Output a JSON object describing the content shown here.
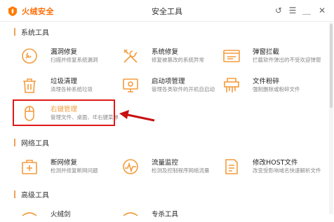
{
  "app": {
    "logo_text": "火绒安全",
    "window_title": "安全工具"
  },
  "controls": {
    "restore": "↺",
    "menu": "☰",
    "minimize": "＿",
    "close": "✕"
  },
  "colors": {
    "accent": "#f39c3d",
    "highlight": "#e01818"
  },
  "sections": [
    {
      "title": "系统工具",
      "items": [
        {
          "title": "漏洞修复",
          "desc": "扫描并修复系统漏洞",
          "icon": "shield-wrench-icon"
        },
        {
          "title": "系统修复",
          "desc": "修复被篡改的系统异常",
          "icon": "tools-icon"
        },
        {
          "title": "弹窗拦截",
          "desc": "拦截软件弹出的不受欢迎弹窗",
          "icon": "popup-window-icon"
        },
        {
          "title": "垃圾清理",
          "desc": "清理各种系统垃圾",
          "icon": "trash-icon"
        },
        {
          "title": "启动项管理",
          "desc": "管理各类软件的开机自启动",
          "icon": "monitor-startup-icon"
        },
        {
          "title": "文件粉碎",
          "desc": "强制删除或粉碎文件",
          "icon": "shredder-icon"
        },
        {
          "title": "右键管理",
          "desc": "管理文件、桌面、IE右键菜单",
          "icon": "mouse-icon"
        }
      ]
    },
    {
      "title": "网络工具",
      "items": [
        {
          "title": "断网修复",
          "desc": "检测并修复断网问题",
          "icon": "network-repair-icon"
        },
        {
          "title": "流量监控",
          "desc": "检测及控制程序网络流量",
          "icon": "traffic-gauge-icon"
        },
        {
          "title": "修改HOST文件",
          "desc": "改变受影响域名快速解析文件",
          "icon": "host-file-icon"
        }
      ]
    },
    {
      "title": "高级工具",
      "items": [
        {
          "title": "火绒剑",
          "icon": "sword-icon"
        },
        {
          "title": "专杀工具",
          "icon": "kill-tool-icon"
        }
      ]
    }
  ]
}
